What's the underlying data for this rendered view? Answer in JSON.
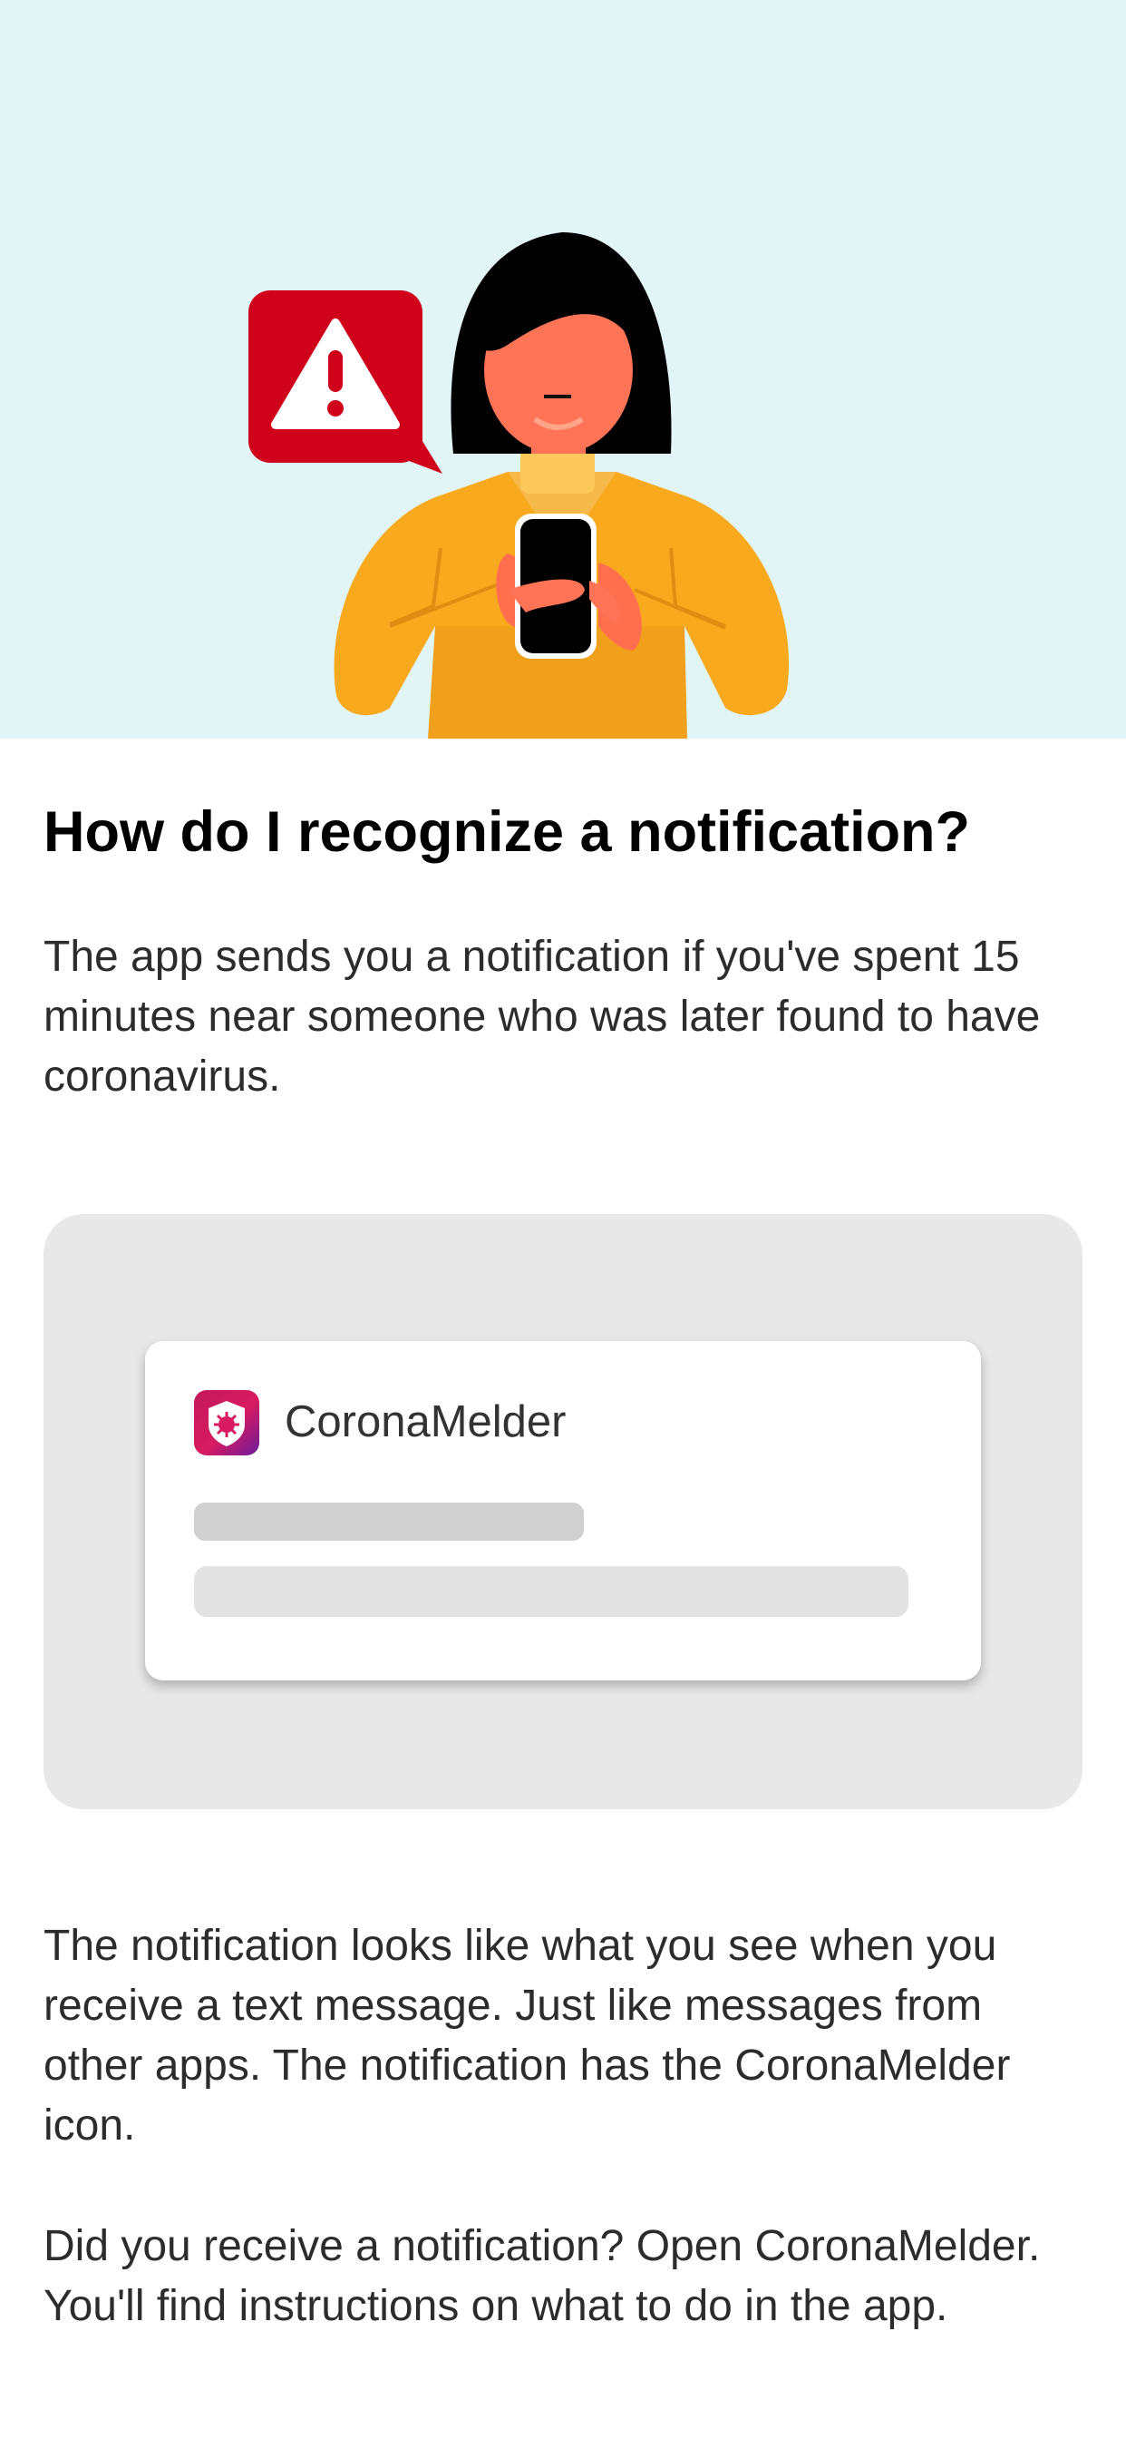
{
  "title": "How do I recognize a notification?",
  "intro": "The app sends you a notification if you've spent 15 minutes near someone who was later found to have coronavirus.",
  "notification_example": {
    "app_name": "CoronaMelder",
    "icon": "coronamelder-shield-icon"
  },
  "body_1": "The notification looks like what you see when you receive a text message. Just like messages from other apps. The notification has the CoronaMelder icon.",
  "body_2": "Did you receive a notification? Open CoronaMelder. You'll find instructions on what to do in the app.",
  "colors": {
    "hero_background": "#e1f5f7",
    "alert_red": "#d0021b",
    "sweater_yellow": "#f9a91e",
    "skin": "#ff7457"
  }
}
